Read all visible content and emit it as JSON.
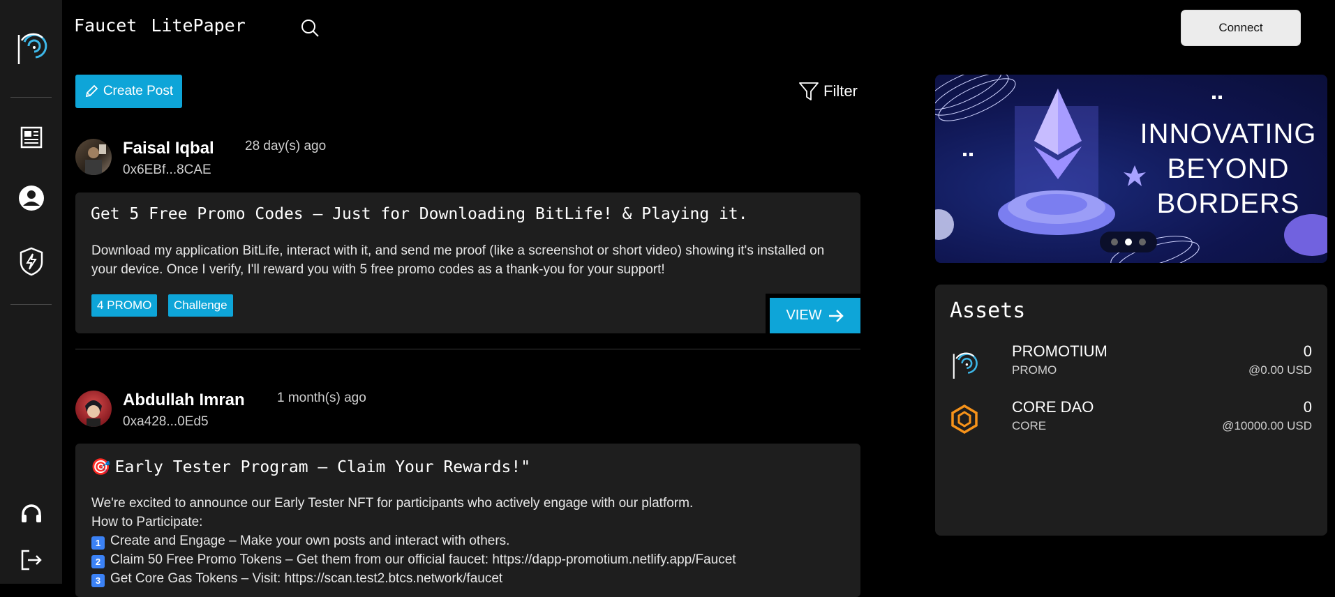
{
  "nav": {
    "faucet": "Faucet",
    "litepaper": "LitePaper",
    "connect": "Connect"
  },
  "toolbar": {
    "create_post": "Create Post",
    "filter": "Filter"
  },
  "posts": [
    {
      "author": "Faisal Iqbal",
      "address": "0x6EBf...8CAE",
      "time": "28 day(s) ago",
      "title": "Get 5 Free Promo Codes – Just for Downloading BitLife! & Playing it.",
      "body": "Download my application BitLife, interact with it, and send me proof (like a screenshot or short video) showing it's installed on your device. Once I verify, I'll reward you with 5 free promo codes as a thank-you for your support!",
      "tags": [
        "4 PROMO",
        "Challenge"
      ],
      "view": "VIEW"
    },
    {
      "author": "Abdullah Imran",
      "address": "0xa428...0Ed5",
      "time": "1 month(s) ago",
      "title_emoji": "🎯",
      "title": "Early Tester Program – Claim Your Rewards!\"",
      "body_lines": [
        "We're excited to announce our Early Tester NFT for participants who actively engage with our platform.",
        "How to Participate:"
      ],
      "steps": [
        {
          "num": "1",
          "text": "Create and Engage – Make your own posts and interact with others."
        },
        {
          "num": "2",
          "text": "Claim 50 Free Promo Tokens – Get them from our official faucet: https://dapp-promotium.netlify.app/Faucet"
        },
        {
          "num": "3",
          "text": "Get Core Gas Tokens – Visit: https://scan.test2.btcs.network/faucet"
        }
      ]
    }
  ],
  "banner": {
    "line1": "INNOVATING",
    "line2": "BEYOND",
    "line3": "BORDERS",
    "active_slide": 2,
    "slide_count": 3
  },
  "assets": {
    "title": "Assets",
    "items": [
      {
        "name": "PROMOTIUM",
        "symbol": "PROMO",
        "balance": "0",
        "usd": "@0.00 USD"
      },
      {
        "name": "CORE DAO",
        "symbol": "CORE",
        "balance": "0",
        "usd": "@10000.00 USD"
      }
    ]
  },
  "colors": {
    "accent": "#0ea5d8",
    "core_orange": "#f7931a"
  }
}
